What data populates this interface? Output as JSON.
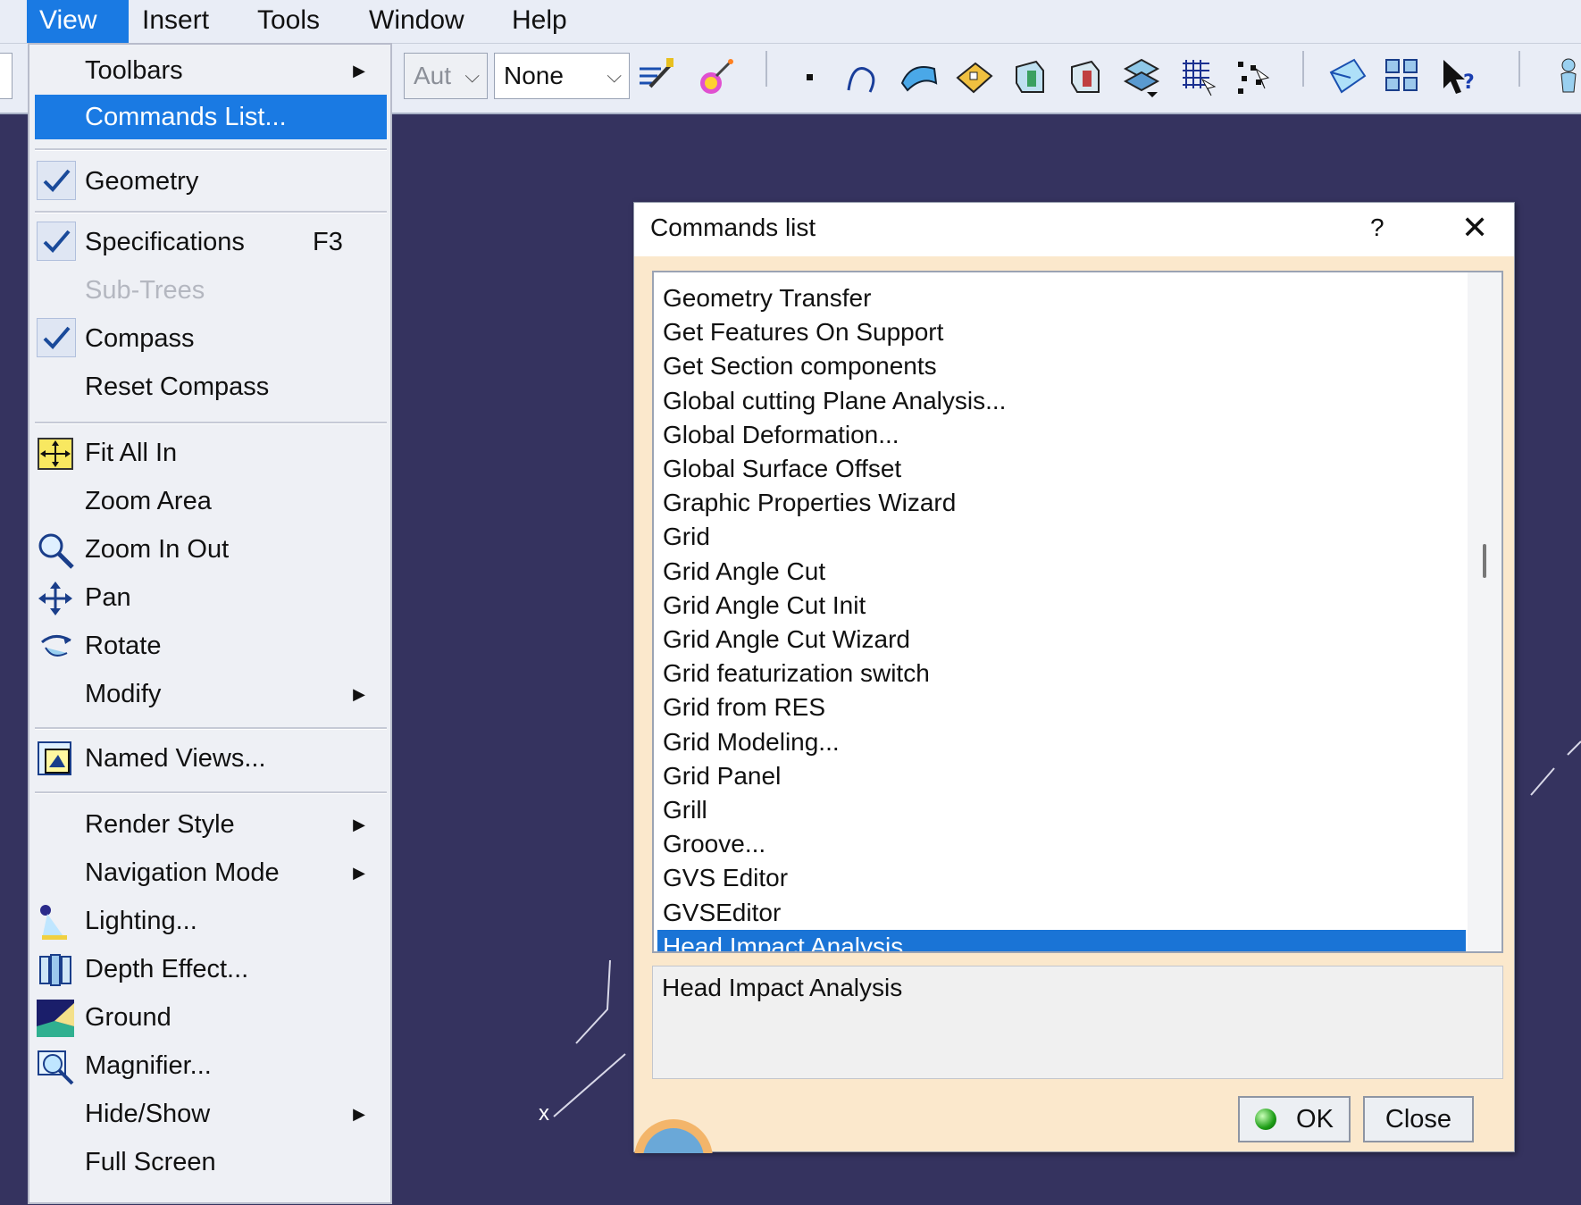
{
  "menubar": {
    "items": [
      {
        "label": "View",
        "active": true
      },
      {
        "label": "Insert",
        "active": false
      },
      {
        "label": "Tools",
        "active": false
      },
      {
        "label": "Window",
        "active": false
      },
      {
        "label": "Help",
        "active": false
      }
    ]
  },
  "toolbar": {
    "combo_disabled": "Aut",
    "combo_value": "None",
    "icons": [
      "paintbrush-icon",
      "magic-wand-icon",
      "point-icon",
      "curve-icon",
      "surface-icon",
      "plane-icon",
      "part-icon",
      "part-icon",
      "assembly-icon",
      "grid-icon",
      "snap-icon",
      "envelope-icon",
      "tile-icon",
      "help-cursor-icon"
    ]
  },
  "menu": {
    "items": [
      {
        "label": "Toolbars",
        "submenu": true
      },
      {
        "label": "Commands List...",
        "highlight": true
      },
      {
        "label": "Geometry",
        "checked": true
      },
      {
        "label": "Specifications",
        "checked": true,
        "shortcut": "F3"
      },
      {
        "label": "Sub-Trees",
        "disabled": true
      },
      {
        "label": "Compass",
        "checked": true
      },
      {
        "label": "Reset Compass"
      },
      {
        "label": "Fit All In",
        "icon": "fit-all-in-icon"
      },
      {
        "label": "Zoom Area"
      },
      {
        "label": "Zoom In Out",
        "icon": "zoom-icon"
      },
      {
        "label": "Pan",
        "icon": "pan-icon"
      },
      {
        "label": "Rotate",
        "icon": "rotate-icon"
      },
      {
        "label": "Modify",
        "submenu": true
      },
      {
        "label": "Named Views...",
        "icon": "named-views-icon"
      },
      {
        "label": "Render Style",
        "submenu": true
      },
      {
        "label": "Navigation Mode",
        "submenu": true
      },
      {
        "label": "Lighting...",
        "icon": "lighting-icon"
      },
      {
        "label": "Depth Effect...",
        "icon": "depth-effect-icon"
      },
      {
        "label": "Ground",
        "icon": "ground-icon"
      },
      {
        "label": "Magnifier...",
        "icon": "magnifier-icon"
      },
      {
        "label": "Hide/Show",
        "submenu": true
      },
      {
        "label": "Full Screen"
      }
    ]
  },
  "dialog": {
    "title": "Commands list",
    "help_glyph": "?",
    "close_glyph": "✕",
    "list": [
      "Geometry Transfer",
      "Get Features On Support",
      "Get Section components",
      "Global cutting Plane Analysis...",
      "Global Deformation...",
      "Global Surface Offset",
      "Graphic Properties Wizard",
      "Grid",
      "Grid Angle Cut",
      "Grid Angle Cut Init",
      "Grid Angle Cut Wizard",
      "Grid featurization switch",
      "Grid from RES",
      "Grid Modeling...",
      "Grid Panel",
      "Grill",
      "Groove...",
      "GVS Editor",
      "GVSEditor",
      "Head Impact Analysis"
    ],
    "selected": "Head Impact Analysis",
    "description": "Head Impact Analysis",
    "ok_label": "OK",
    "close_label": "Close"
  },
  "viewport": {
    "axis_label": "x"
  },
  "colors": {
    "background": "#35335f",
    "highlight": "#1a7ae3",
    "dialog_bg": "#fbe8cc"
  }
}
